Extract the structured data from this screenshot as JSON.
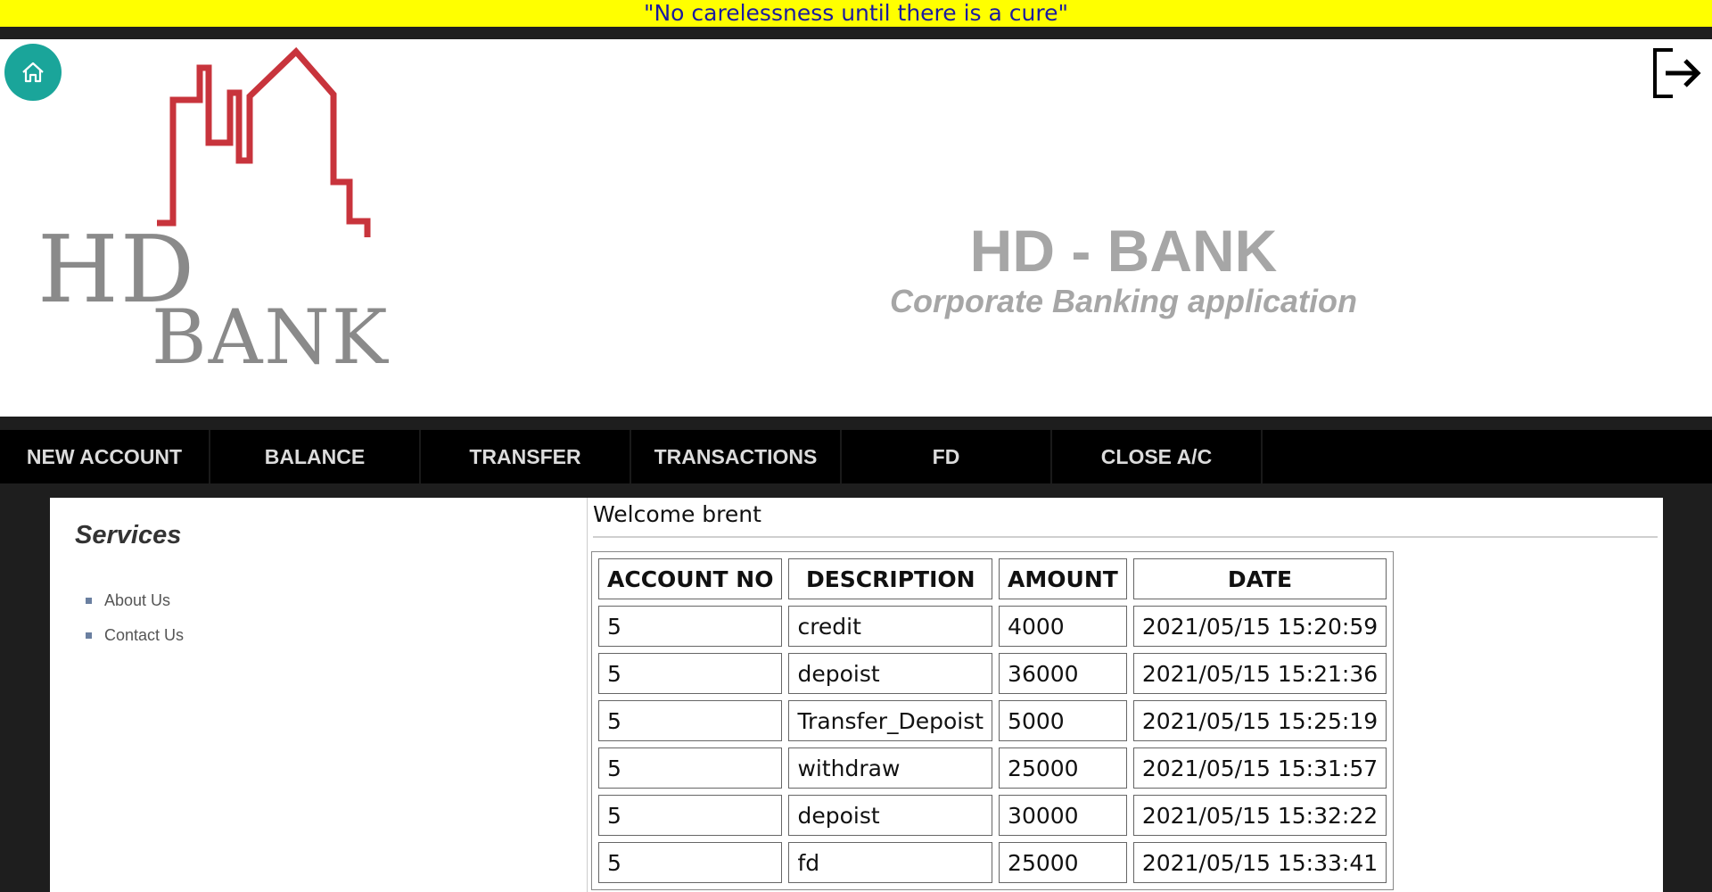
{
  "marquee": {
    "text": "\"No carelessness until there is a cure\""
  },
  "header": {
    "logo": {
      "top": "HD",
      "bottom": "BANK"
    },
    "title": "HD - BANK",
    "subtitle": "Corporate Banking application"
  },
  "nav": {
    "items": [
      {
        "label": "NEW ACCOUNT"
      },
      {
        "label": "BALANCE"
      },
      {
        "label": "TRANSFER"
      },
      {
        "label": "TRANSACTIONS"
      },
      {
        "label": "FD"
      },
      {
        "label": "CLOSE A/C"
      }
    ]
  },
  "sidebar": {
    "title": "Services",
    "links": [
      {
        "label": "About Us"
      },
      {
        "label": "Contact Us"
      }
    ]
  },
  "main": {
    "welcome": "Welcome brent",
    "table": {
      "headers": [
        "ACCOUNT NO",
        "DESCRIPTION",
        "AMOUNT",
        "DATE"
      ],
      "rows": [
        [
          "5",
          "credit",
          "4000",
          "2021/05/15 15:20:59"
        ],
        [
          "5",
          "depoist",
          "36000",
          "2021/05/15 15:21:36"
        ],
        [
          "5",
          "Transfer_Depoist",
          "5000",
          "2021/05/15 15:25:19"
        ],
        [
          "5",
          "withdraw",
          "25000",
          "2021/05/15 15:31:57"
        ],
        [
          "5",
          "depoist",
          "30000",
          "2021/05/15 15:32:22"
        ],
        [
          "5",
          "fd",
          "25000",
          "2021/05/15 15:33:41"
        ]
      ]
    }
  },
  "icons": {
    "home": "home-icon",
    "logout": "logout-icon"
  },
  "colors": {
    "marquee_bg": "#ffff00",
    "marquee_text": "#1a1aa0",
    "home_btn": "#1aa59a",
    "logo_red": "#c8343c",
    "title_gray": "#a6a6a6"
  }
}
